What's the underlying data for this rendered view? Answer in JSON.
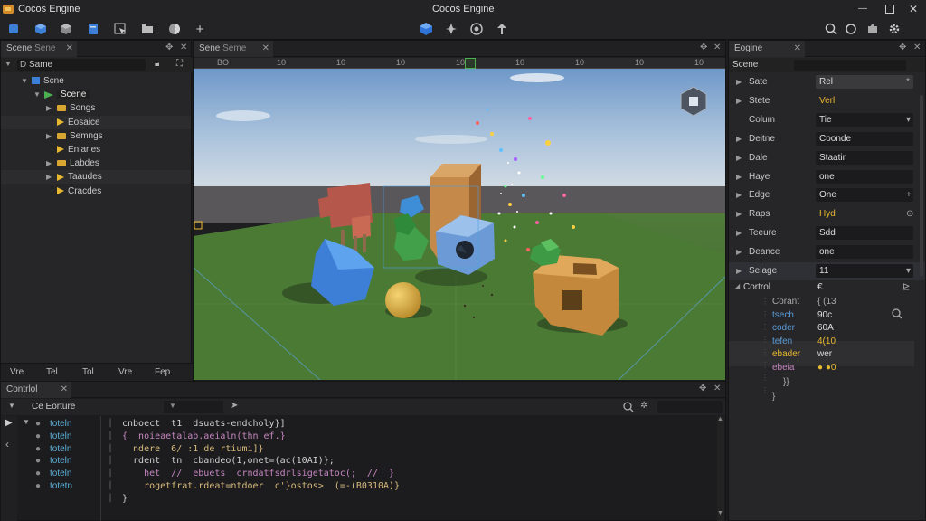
{
  "app": {
    "title": "Cocos Engine"
  },
  "toolbar": {
    "left_icons": [
      "move-tool-icon",
      "cube-icon",
      "box-icon",
      "document-icon",
      "select-tool-icon",
      "folder-icon",
      "sphere-icon",
      "add-icon"
    ],
    "center_icons": [
      "cube-icon",
      "pin-icon",
      "globe-icon",
      "upload-icon"
    ],
    "right_icons": [
      "search-icon",
      "circle-icon",
      "puzzle-icon",
      "settings-icon"
    ]
  },
  "hierarchy": {
    "tab": "Scene",
    "tab2": "Sene",
    "search": "Same",
    "nodes": [
      {
        "label": "Scne",
        "depth": 0,
        "arrow": "▼",
        "kind": "scene"
      },
      {
        "label": "Scene",
        "depth": 1,
        "arrow": "▼",
        "kind": "scene-green",
        "selected": true
      },
      {
        "label": "Songs",
        "depth": 2,
        "arrow": "▶",
        "kind": "folder"
      },
      {
        "label": "Eosaice",
        "depth": 2,
        "arrow": "",
        "kind": "play",
        "alt": true
      },
      {
        "label": "Semngs",
        "depth": 2,
        "arrow": "▶",
        "kind": "folder"
      },
      {
        "label": "Eniaries",
        "depth": 2,
        "arrow": "",
        "kind": "play"
      },
      {
        "label": "Labdes",
        "depth": 2,
        "arrow": "▶",
        "kind": "folder"
      },
      {
        "label": "Taaudes",
        "depth": 2,
        "arrow": "▶",
        "kind": "play",
        "alt": true
      },
      {
        "label": "Cracdes",
        "depth": 2,
        "arrow": "",
        "kind": "play"
      }
    ],
    "footer": [
      "Vre",
      "Tel",
      "Tol",
      "Vre",
      "Fep"
    ]
  },
  "scene": {
    "tab": "Sene",
    "tab2": "Seme",
    "ruler": [
      "BO",
      "10",
      "10",
      "10",
      "10",
      "10",
      "10",
      "10",
      "10",
      "10"
    ]
  },
  "inspector": {
    "tab": "Eogine",
    "header": "Scene",
    "rows": [
      {
        "label": "Sate",
        "value": "Rel",
        "arrow": "▶",
        "hl": true,
        "extra": "*"
      },
      {
        "label": "Stete",
        "value": "Verl",
        "arrow": "▶",
        "plain": true
      },
      {
        "label": "Colum",
        "value": "Tie",
        "arrow": "",
        "extra": "▾"
      },
      {
        "label": "Deitne",
        "value": "Coonde",
        "arrow": "▶"
      },
      {
        "label": "Dale",
        "value": "Staatir",
        "arrow": "▶"
      },
      {
        "label": "Haye",
        "value": "one",
        "arrow": "▶"
      },
      {
        "label": "Edge",
        "value": "One",
        "arrow": "▶",
        "extra": "+"
      },
      {
        "label": "Raps",
        "value": "Hyd",
        "arrow": "▶",
        "plain": true,
        "extra": "⊙"
      },
      {
        "label": "Teeure",
        "value": "Sdd",
        "arrow": "▶"
      },
      {
        "label": "Deance",
        "value": "one",
        "arrow": "▶"
      },
      {
        "label": "Selage",
        "value": "11",
        "arrow": "▶",
        "sel": true,
        "extra": "▾"
      }
    ],
    "code_header": "Cortrol",
    "code_header_val": "€",
    "code_rows": [
      {
        "k": "Corant",
        "v": "{ (13",
        "kc": "#aaa",
        "vc": "#aaa"
      },
      {
        "k": "tsech",
        "v": "90c",
        "kc": "#5b9bd5",
        "vc": "#ddd"
      },
      {
        "k": "coder",
        "v": "60A",
        "kc": "#5b9bd5",
        "vc": "#ddd"
      },
      {
        "k": "tefen",
        "v": "4(10",
        "kc": "#5b9bd5",
        "vc": "#e8b830"
      },
      {
        "k": "ebader",
        "v": "wer",
        "kc": "#e8b830",
        "vc": "#ddd"
      },
      {
        "k": "ebeia",
        "v": "● ●0",
        "kc": "#c586c0",
        "vc": "#e8b830"
      }
    ],
    "brace1": "}}",
    "brace2": "}"
  },
  "console": {
    "tab": "Contrlol",
    "sub": "Ce Eorture",
    "labels": [
      "toteln",
      "toteln",
      "toteln",
      "toteln",
      "toteln",
      "totetn"
    ],
    "code": [
      "cnboect  t1  dsuats-endcholy}]",
      "{  noieaetalab.aeialn(thn ef.}",
      "  ndere  6/ :1 de rtiumi]}",
      "  rdent  tn  cbandeo(1,onet=(ac(10AI)};",
      "    het  //  ebuets  crndatfsdrlsigetatoc(;  //  }",
      "    rogetfrat.rdeat=ntdoer  c'}ostos>  (=-(B0310A)}",
      "}"
    ]
  },
  "colors": {
    "accent": "#3b82f6",
    "brand": "#e8b830",
    "panel": "#262628"
  }
}
